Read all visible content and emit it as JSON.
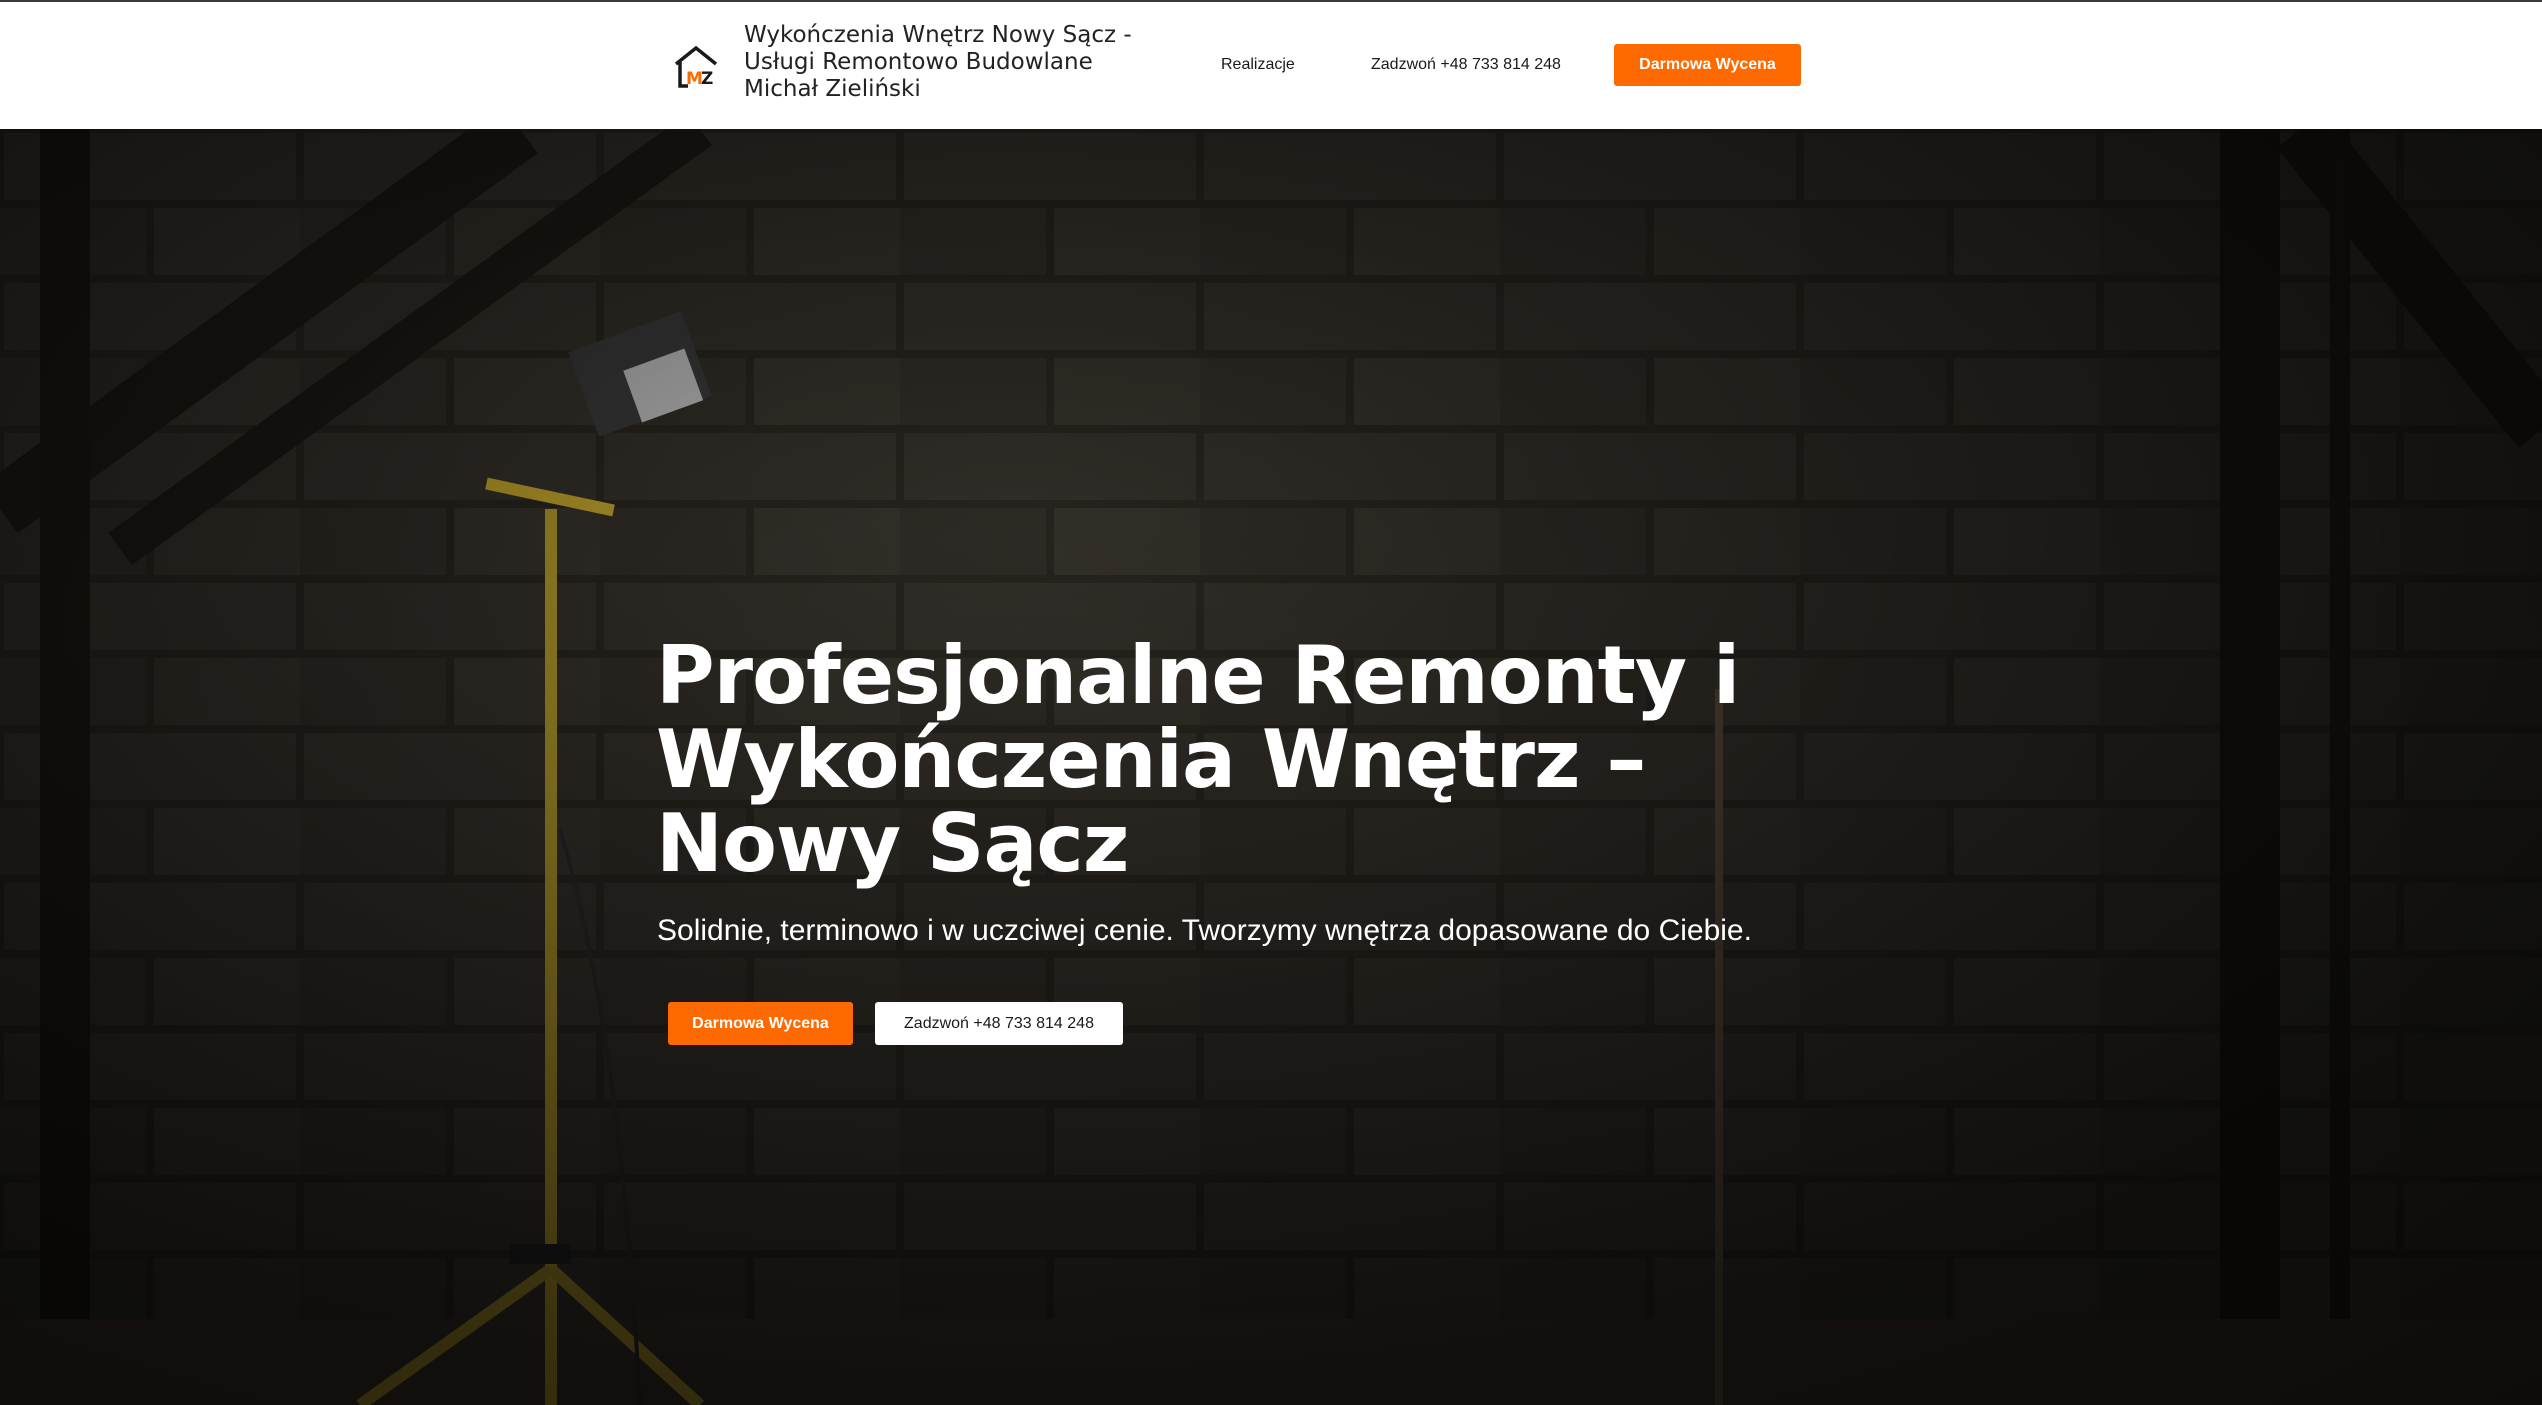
{
  "header": {
    "brand_title": "Wykończenia Wnętrz Nowy Sącz - Usługi Remontowo Budowlane Michał Zieliński",
    "logo_letters": "MZ",
    "nav": {
      "realizacje": "Realizacje",
      "phone": "Zadzwoń +48 733 814 248"
    },
    "cta_label": "Darmowa Wycena"
  },
  "hero": {
    "headline": "Profesjonalne Remonty i Wykończenia Wnętrz – Nowy Sącz",
    "subheadline": "Solidnie, terminowo i w uczciwej cenie. Tworzymy wnętrza dopasowane do Ciebie.",
    "primary_button": "Darmowa Wycena",
    "secondary_button": "Zadzwoń +48 733 814 248"
  },
  "colors": {
    "accent": "#ff6a00",
    "header_bg": "#ffffff",
    "hero_text": "#ffffff"
  },
  "icons": {
    "logo": "house-mz-logo-icon"
  }
}
